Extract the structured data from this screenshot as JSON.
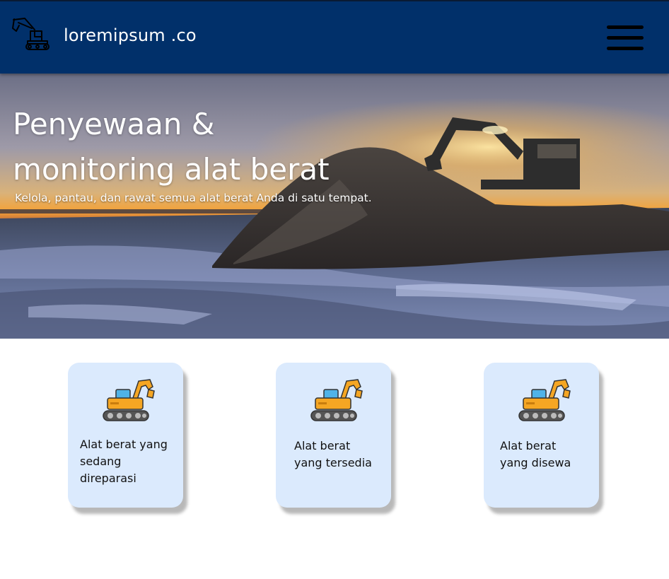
{
  "header": {
    "brand": "loremipsum .co",
    "logo_icon": "excavator-outline-icon",
    "menu_icon": "hamburger-menu-icon"
  },
  "hero": {
    "title_line1": "Penyewaan &",
    "title_line2": "monitoring alat berat",
    "subtitle": "Kelola, pantau, dan rawat semua alat berat Anda di satu tempat."
  },
  "cards": [
    {
      "icon": "excavator-icon",
      "lines": [
        "Alat berat yang",
        "sedang",
        "direparasi"
      ]
    },
    {
      "icon": "excavator-icon",
      "lines": [
        "Alat berat",
        "yang tersedia"
      ]
    },
    {
      "icon": "excavator-icon",
      "lines": [
        "Alat berat",
        "yang disewa"
      ]
    }
  ],
  "colors": {
    "navbar": "#01306a",
    "card_bg": "#dbeafd",
    "excavator_body": "#f5a623",
    "excavator_cab": "#4fb3e8",
    "track": "#555555"
  }
}
